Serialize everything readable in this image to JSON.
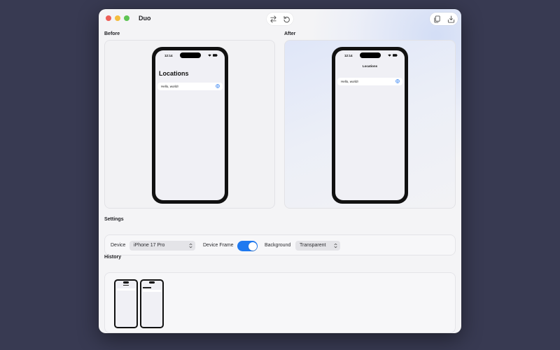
{
  "window": {
    "app_title": "Duo"
  },
  "toolbar": {
    "swap_icon": "swap-arrows-icon",
    "reset_icon": "rotate-left-icon",
    "copy_icon": "copy-icon",
    "save_icon": "save-tray-icon"
  },
  "before": {
    "label": "Before",
    "phone": {
      "time": "12:14",
      "title": "Locations",
      "row_text": "Hello, world!"
    }
  },
  "after": {
    "label": "After",
    "phone": {
      "time": "12:14",
      "title": "Locations",
      "row_text": "Hello, world!"
    }
  },
  "settings": {
    "label": "Settings",
    "device_label": "Device",
    "device_value": "iPhone 17 Pro",
    "frame_label": "Device Frame",
    "frame_enabled": true,
    "background_label": "Background",
    "background_value": "Transparent"
  },
  "history": {
    "label": "History",
    "items": [
      {
        "style": "inline-title"
      },
      {
        "style": "large-title"
      }
    ]
  },
  "colors": {
    "accent": "#1f79f0",
    "window_bg": "#f4f4f6",
    "desktop_bg": "#383a52"
  }
}
